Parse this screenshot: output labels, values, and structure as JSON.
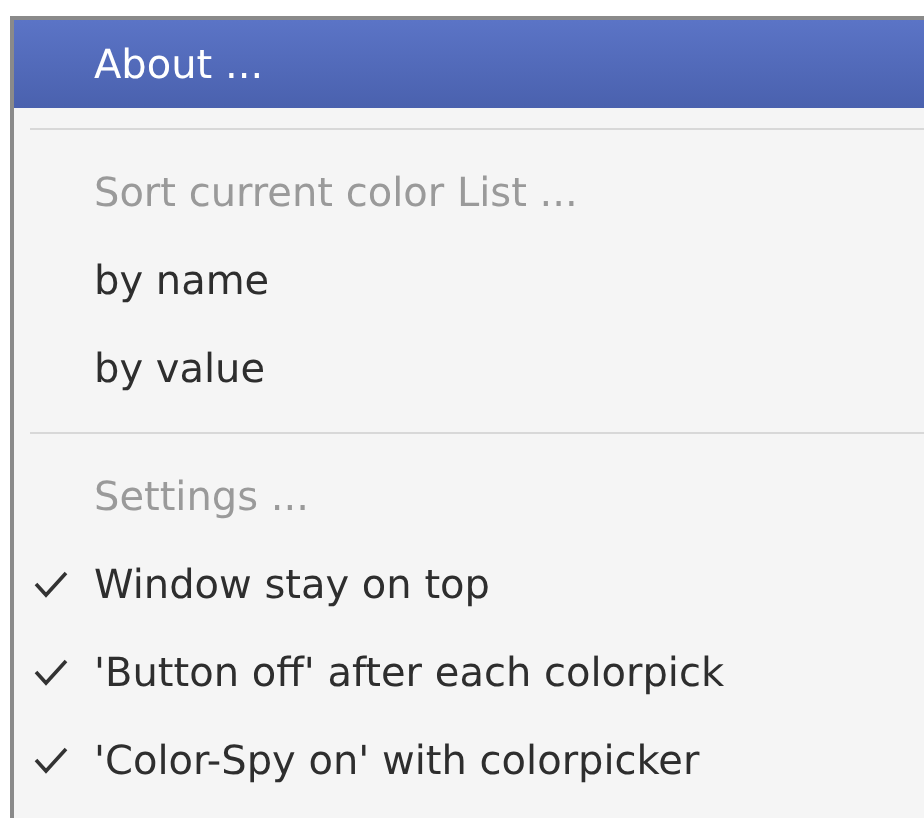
{
  "menu": {
    "items": [
      {
        "kind": "item",
        "label": "About ...",
        "selected": true
      },
      {
        "kind": "separator"
      },
      {
        "kind": "header",
        "label": "Sort current color List ..."
      },
      {
        "kind": "item",
        "label": "by name",
        "selected": false
      },
      {
        "kind": "item",
        "label": "by value",
        "selected": false
      },
      {
        "kind": "separator"
      },
      {
        "kind": "header",
        "label": "Settings ..."
      },
      {
        "kind": "check",
        "label": "Window stay on top",
        "checked": true,
        "selected": false
      },
      {
        "kind": "check",
        "label": "'Button off' after each colorpick",
        "checked": true,
        "selected": false
      },
      {
        "kind": "check",
        "label": "'Color-Spy on' with colorpicker",
        "checked": true,
        "selected": false
      }
    ]
  }
}
